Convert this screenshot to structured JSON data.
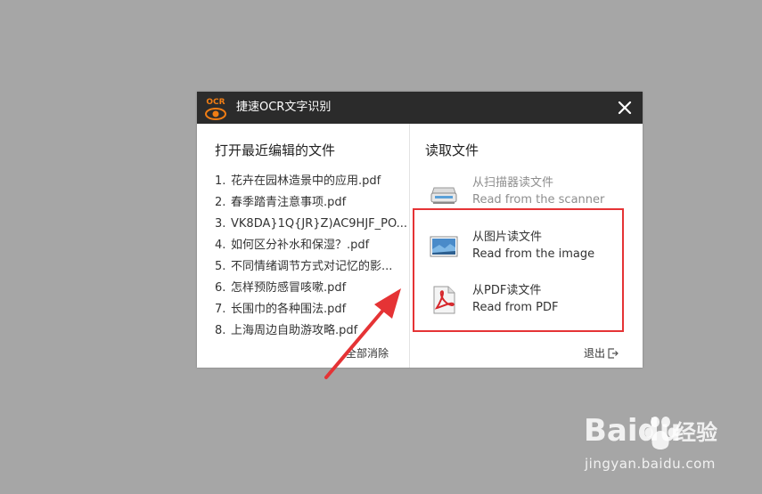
{
  "window": {
    "title": "捷速OCR文字识别",
    "logo_text": "OCR"
  },
  "recent": {
    "heading": "打开最近编辑的文件",
    "items": [
      {
        "index": "1.",
        "name": "花卉在园林造景中的应用.pdf"
      },
      {
        "index": "2.",
        "name": "春季踏青注意事项.pdf"
      },
      {
        "index": "3.",
        "name": "VK8DA}1Q{JR}Z)AC9HJF_PO..."
      },
      {
        "index": "4.",
        "name": "如何区分补水和保湿？.pdf"
      },
      {
        "index": "5.",
        "name": "不同情绪调节方式对记忆的影..."
      },
      {
        "index": "6.",
        "name": "怎样预防感冒咳嗽.pdf"
      },
      {
        "index": "7.",
        "name": "长围巾的各种围法.pdf"
      },
      {
        "index": "8.",
        "name": "上海周边自助游攻略.pdf"
      }
    ],
    "clear_label": "全部消除"
  },
  "read": {
    "heading": "读取文件",
    "actions": [
      {
        "zh": "从扫描器读文件",
        "en": "Read from the scanner",
        "icon": "scanner-icon",
        "enabled": false
      },
      {
        "zh": "从图片读文件",
        "en": "Read from the image",
        "icon": "image-icon",
        "enabled": true
      },
      {
        "zh": "从PDF读文件",
        "en": "Read from PDF",
        "icon": "pdf-icon",
        "enabled": true
      }
    ],
    "exit_label": "退出"
  },
  "annotation": {
    "highlight_color": "#e53335"
  },
  "watermark": {
    "brand": "Baidu",
    "brand_cn": "经验",
    "url": "jingyan.baidu.com"
  },
  "colors": {
    "background": "#a6a6a6",
    "titlebar": "#2b2b2b",
    "logo_orange": "#f07d14",
    "pdf_red": "#d6262b"
  }
}
